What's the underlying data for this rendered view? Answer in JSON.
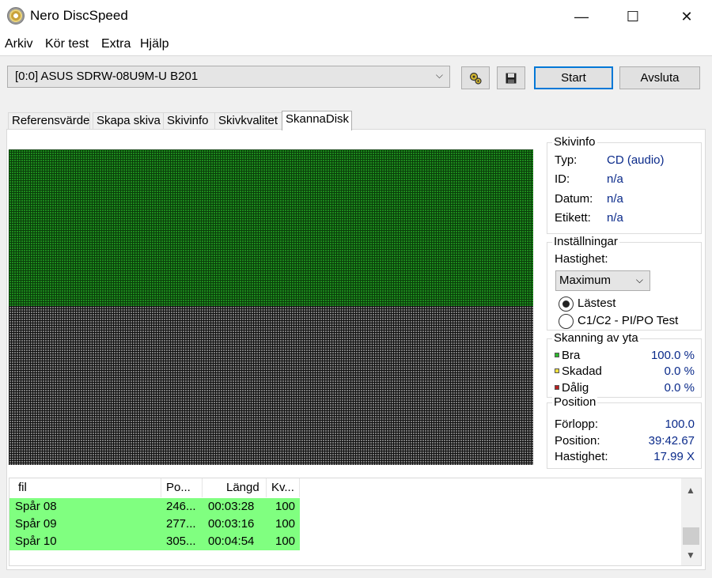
{
  "window": {
    "title": "Nero DiscSpeed",
    "min": "—",
    "max": "☐",
    "close": "✕"
  },
  "menu": [
    "Arkiv",
    "Kör test",
    "Extra",
    "Hjälp"
  ],
  "toolbar": {
    "drive": "[0:0]   ASUS SDRW-08U9M-U B201",
    "start_label": "Start",
    "quit_label": "Avsluta"
  },
  "tabs": [
    "Referensvärde",
    "Skapa skiva",
    "Skivinfo",
    "Skivkvalitet",
    "SkannaDisk"
  ],
  "active_tab": 4,
  "discinfo": {
    "title": "Skivinfo",
    "rows": [
      {
        "label": "Typ:",
        "value": "CD (audio)"
      },
      {
        "label": "ID:",
        "value": "n/a"
      },
      {
        "label": "Datum:",
        "value": "n/a"
      },
      {
        "label": "Etikett:",
        "value": "n/a"
      }
    ]
  },
  "settings": {
    "title": "Inställningar",
    "speed_label": "Hastighet:",
    "speed_value": "Maximum",
    "radio_read": "Lästest",
    "radio_c1c2": "C1/C2 - PI/PO Test"
  },
  "surface": {
    "title": "Skanning av yta",
    "good_label": "Bra",
    "good_value": "100.0 %",
    "good_color": "#2db82d",
    "damaged_label": "Skadad",
    "damaged_value": "0.0 %",
    "damaged_color": "#f0e040",
    "bad_label": "Dålig",
    "bad_value": "0.0 %",
    "bad_color": "#b82020"
  },
  "position": {
    "title": "Position",
    "progress_label": "Förlopp:",
    "progress_value": "100.0",
    "position_label": "Position:",
    "position_value": "39:42.67",
    "speed_label": "Hastighet:",
    "speed_value": "17.99 X"
  },
  "tracklist": {
    "headers": [
      "fil",
      "Po...",
      "Längd",
      "Kv..."
    ],
    "rows": [
      {
        "file": "Spår 08",
        "pos": "246...",
        "length": "00:03:28",
        "quality": "100"
      },
      {
        "file": "Spår 09",
        "pos": "277...",
        "length": "00:03:16",
        "quality": "100"
      },
      {
        "file": "Spår 10",
        "pos": "305...",
        "length": "00:04:54",
        "quality": "100"
      }
    ]
  }
}
